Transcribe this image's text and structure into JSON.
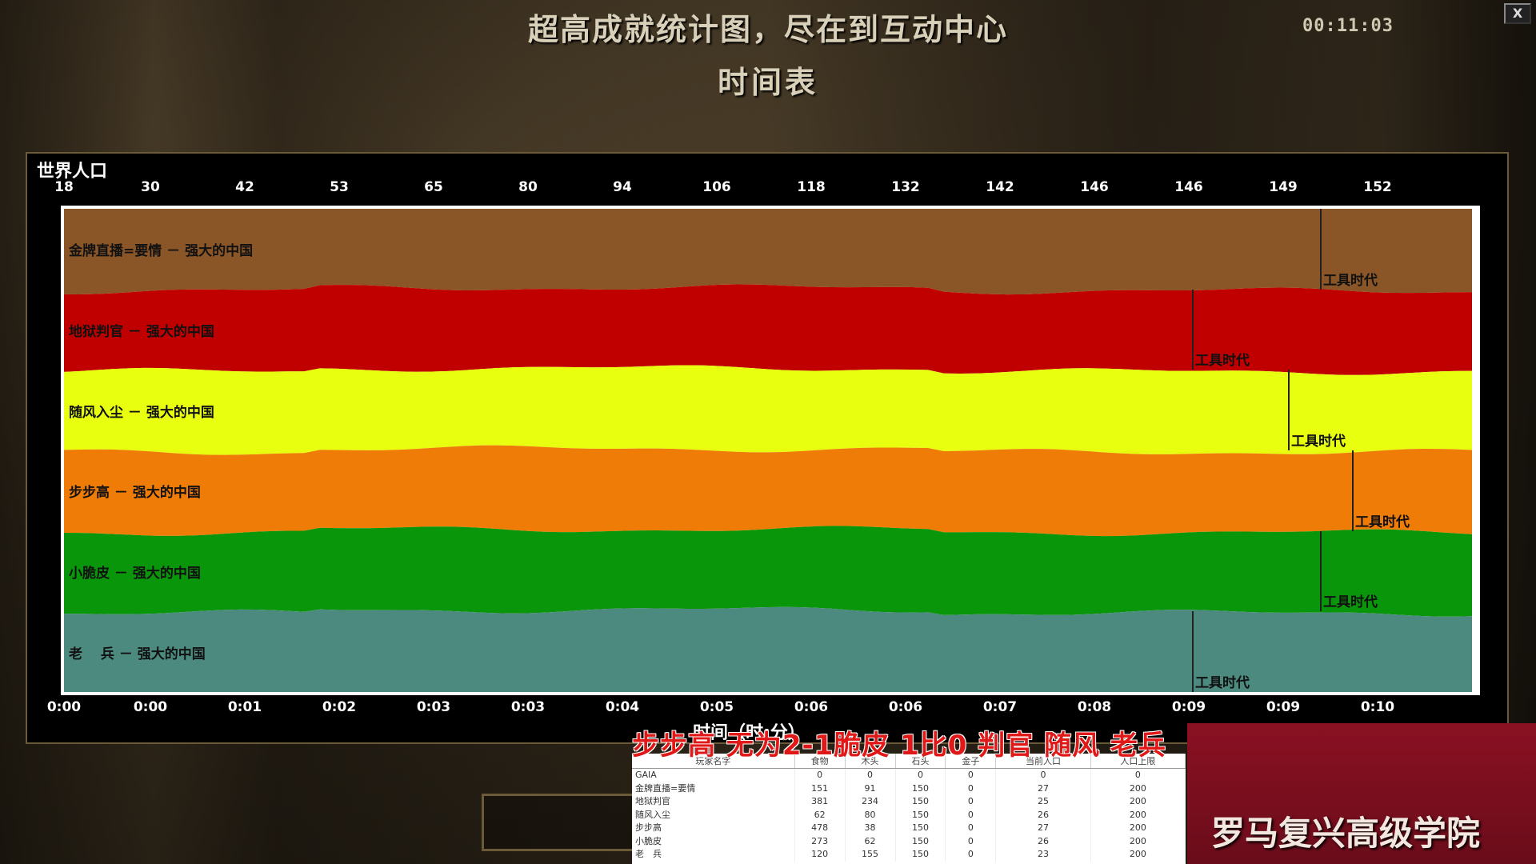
{
  "header": {
    "title": "超高成就统计图，尽在到互动中心",
    "subtitle": "时间表",
    "clock": "00:11:03",
    "close_label": "X"
  },
  "chart_data": {
    "type": "area",
    "title": "世界人口",
    "xlabel": "时间（时:分）",
    "top_ticks": [
      "18",
      "30",
      "42",
      "53",
      "65",
      "80",
      "94",
      "106",
      "118",
      "132",
      "142",
      "146",
      "146",
      "149",
      "152"
    ],
    "x_ticks": [
      "0:00",
      "0:00",
      "0:01",
      "0:02",
      "0:03",
      "0:03",
      "0:04",
      "0:05",
      "0:06",
      "0:06",
      "0:07",
      "0:08",
      "0:09",
      "0:09",
      "0:10"
    ],
    "series": [
      {
        "name": "金牌直播=要情 － 强大的中国",
        "color": "#8a5628",
        "age_up": "0:10",
        "age_label": "工具时代"
      },
      {
        "name": "地狱判官 － 强大的中国",
        "color": "#c00000",
        "age_up": "0:09",
        "age_label": "工具时代"
      },
      {
        "name": "随风入尘 － 强大的中国",
        "color": "#e8ff10",
        "age_up": "0:09",
        "age_label": "工具时代"
      },
      {
        "name": "步步高 － 强大的中国",
        "color": "#f07c08",
        "age_up": "0:10",
        "age_label": "工具时代"
      },
      {
        "name": "小脆皮 － 强大的中国",
        "color": "#0a960a",
        "age_up": "0:10",
        "age_label": "工具时代"
      },
      {
        "name": "老　 兵 － 强大的中国",
        "color": "#4c8a80",
        "age_up": "0:09",
        "age_label": "工具时代"
      }
    ]
  },
  "overlay": {
    "caption": "步步高 无为2-1脆皮  1比0 判官 随风 老兵",
    "logo_text": "罗马复兴高级学院"
  },
  "stats_table": {
    "headers": [
      "玩家名字",
      "食物",
      "木头",
      "石头",
      "金子",
      "当前人口",
      "人口上限"
    ],
    "rows": [
      [
        "GAIA",
        "0",
        "0",
        "0",
        "0",
        "0",
        "0"
      ],
      [
        "金牌直播=要情",
        "151",
        "91",
        "150",
        "0",
        "27",
        "200"
      ],
      [
        "地狱判官",
        "381",
        "234",
        "150",
        "0",
        "25",
        "200"
      ],
      [
        "随风入尘",
        "62",
        "80",
        "150",
        "0",
        "26",
        "200"
      ],
      [
        "步步高",
        "478",
        "38",
        "150",
        "0",
        "27",
        "200"
      ],
      [
        "小脆皮",
        "273",
        "62",
        "150",
        "0",
        "26",
        "200"
      ],
      [
        "老　兵",
        "120",
        "155",
        "150",
        "0",
        "23",
        "200"
      ]
    ]
  }
}
